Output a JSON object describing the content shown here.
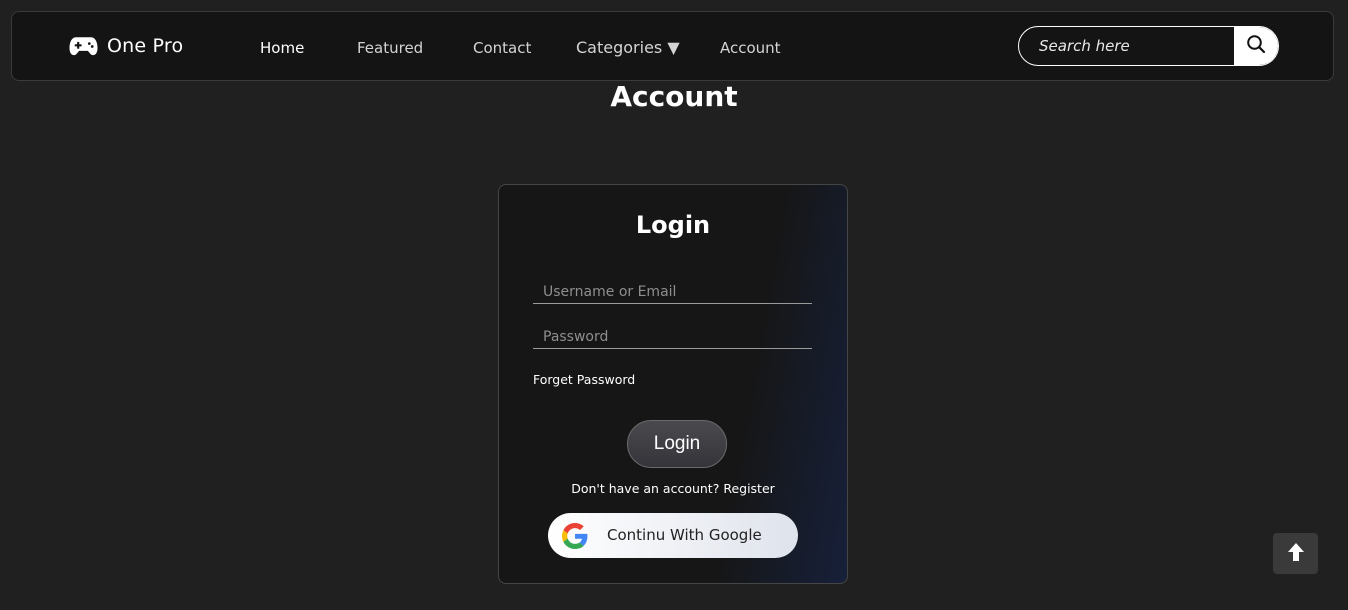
{
  "nav": {
    "logo_icon": "gamepad-icon",
    "logo_text": "One Pro",
    "links": [
      {
        "label": "Home",
        "active": true
      },
      {
        "label": "Featured"
      },
      {
        "label": "Contact"
      },
      {
        "label": "Categories ▼"
      },
      {
        "label": "Account"
      }
    ],
    "search": {
      "placeholder": "Search here",
      "icon": "search-icon"
    }
  },
  "page": {
    "title": "Account"
  },
  "login": {
    "title": "Login",
    "username_placeholder": "Username or Email",
    "password_placeholder": "Password",
    "forgot_label": "Forget Password",
    "submit_label": "Login",
    "register_prompt": "Don't have an account?",
    "register_label": "Register",
    "google_label": "Continu With Google",
    "google_icon": "google-icon"
  },
  "scroll_top_icon": "arrow-up-icon",
  "colors": {
    "background": "#202020",
    "navbar": "#141414",
    "card_gradient_end": "#17203a"
  }
}
